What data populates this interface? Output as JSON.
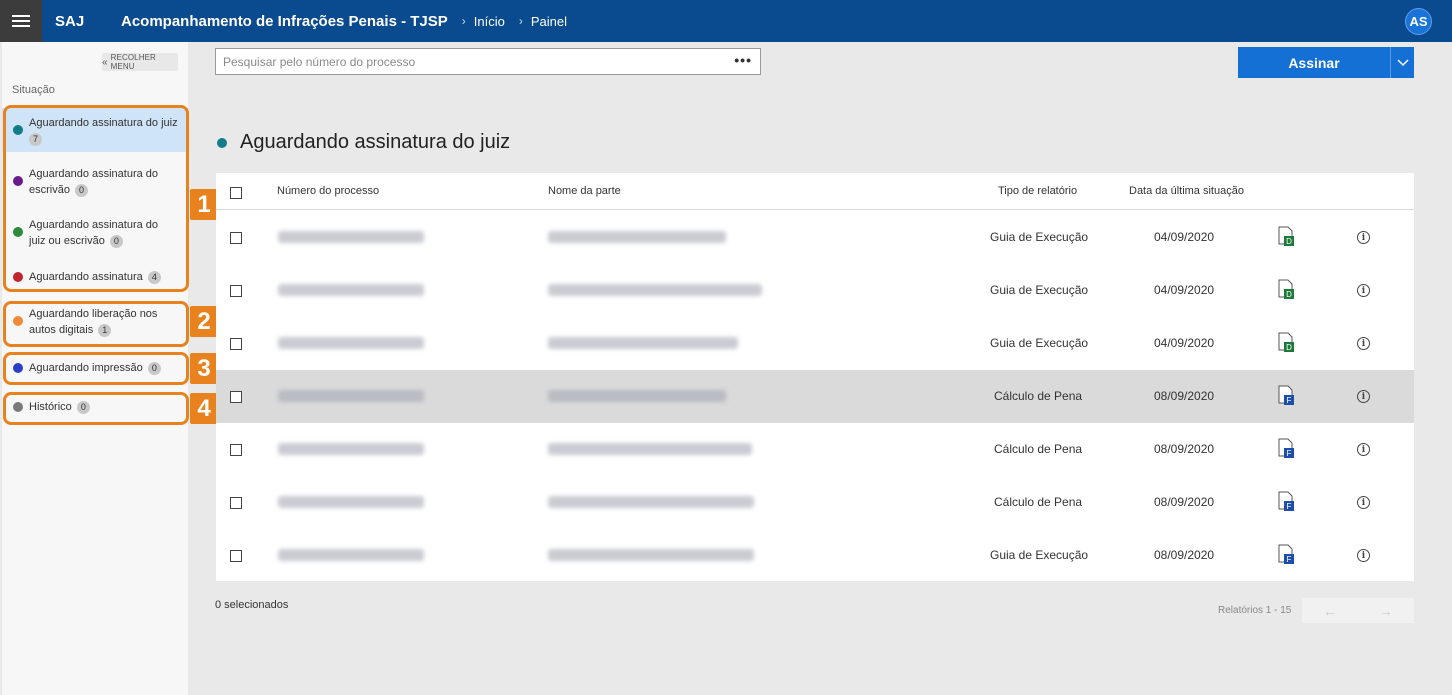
{
  "topbar": {
    "brand": "SAJ",
    "title": "Acompanhamento de Infrações Penais - TJSP",
    "breadcrumbs": [
      "Início",
      "Painel"
    ],
    "avatar": "AS"
  },
  "sidebar": {
    "collapse_label": "RECOLHER MENU",
    "section_label": "Situação",
    "items": [
      {
        "label": "Aguardando assinatura do juiz",
        "count": "7",
        "color": "#127c8a"
      },
      {
        "label": "Aguardando assinatura do escrivão",
        "count": "0",
        "color": "#6a1b8a"
      },
      {
        "label": "Aguardando assinatura do juiz ou escrivão",
        "count": "0",
        "color": "#2e8b3c"
      },
      {
        "label": "Aguardando assinatura",
        "count": "4",
        "color": "#c0262d"
      },
      {
        "label": "Aguardando liberação nos autos digitais",
        "count": "1",
        "color": "#f08a3a"
      },
      {
        "label": "Aguardando impressão",
        "count": "0",
        "color": "#2a3fc7"
      },
      {
        "label": "Histórico",
        "count": "0",
        "color": "#7a7a7a"
      }
    ],
    "markers": [
      "1",
      "2",
      "3",
      "4"
    ]
  },
  "search": {
    "placeholder": "Pesquisar pelo número do processo",
    "more": "•••"
  },
  "actions": {
    "sign_label": "Assinar"
  },
  "main": {
    "section_title": "Aguardando assinatura do juiz",
    "columns": [
      "Número do processo",
      "Nome da parte",
      "Tipo de relatório",
      "Data da última situação"
    ],
    "rows": [
      {
        "tipo": "Guia de Execução",
        "data": "04/09/2020",
        "doc": "D"
      },
      {
        "tipo": "Guia de Execução",
        "data": "04/09/2020",
        "doc": "D"
      },
      {
        "tipo": "Guia de Execução",
        "data": "04/09/2020",
        "doc": "D"
      },
      {
        "tipo": "Cálculo de Pena",
        "data": "08/09/2020",
        "doc": "F"
      },
      {
        "tipo": "Cálculo de Pena",
        "data": "08/09/2020",
        "doc": "F"
      },
      {
        "tipo": "Cálculo de Pena",
        "data": "08/09/2020",
        "doc": "F"
      },
      {
        "tipo": "Guia de Execução",
        "data": "08/09/2020",
        "doc": "F"
      }
    ],
    "selected_label": "0 selecionados",
    "pager_label": "Relatórios 1 - 15",
    "prev": "←",
    "next": "→"
  },
  "colors": {
    "header": "#0a4a8e",
    "accent": "#1470d4",
    "highlight": "#e8821e",
    "doc_d": "#1e7a3a",
    "doc_f": "#1d4ea8"
  }
}
